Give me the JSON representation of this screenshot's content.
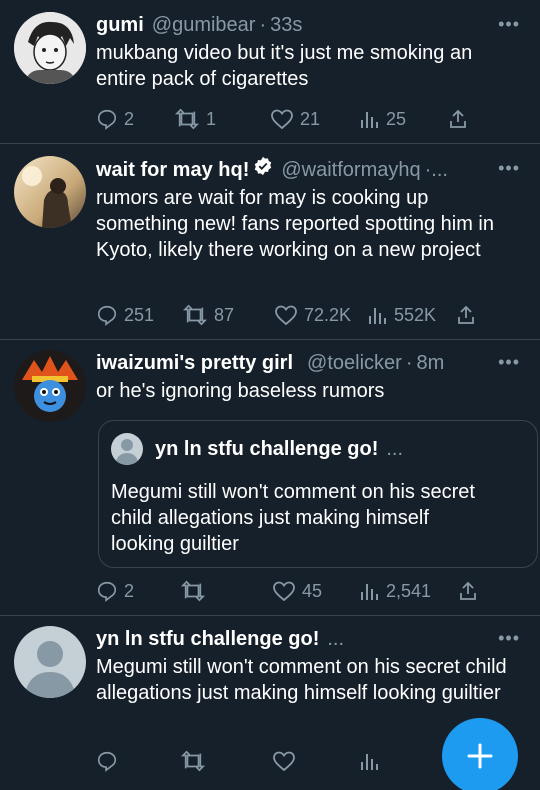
{
  "tweets": [
    {
      "name": "gumi",
      "handle": "@gumibear",
      "dot": "·",
      "time": "33s",
      "more": "•••",
      "text": "mukbang video but it's just me smoking an entire pack of cigarettes",
      "replies": "2",
      "retweets": "1",
      "likes": "21",
      "views": "25"
    },
    {
      "name": "wait for may hq!",
      "verified": true,
      "handle": "@waitformayhq",
      "dot": "·...",
      "more": "•••",
      "text": "rumors are wait for may is cooking up something new! fans reported spotting him in Kyoto, likely there working on a new project",
      "replies": "251",
      "retweets": "87",
      "likes": "72.2K",
      "views": "552K"
    },
    {
      "name": "iwaizumi's pretty girl",
      "handle": "@toelicker",
      "dot": "·",
      "time": "8m",
      "more": "•••",
      "text": "or he's ignoring baseless rumors",
      "quote": {
        "name": "yn ln stfu challenge go!",
        "ellipsis": "...",
        "text": "Megumi still won't comment on his secret child allegations just making himself looking guiltier"
      },
      "replies": "2",
      "retweets": "",
      "likes": "45",
      "views": "2,541"
    },
    {
      "name": "yn ln stfu challenge go!",
      "handle": "...",
      "more": "•••",
      "text": "Megumi still won't comment on his secret child allegations just making himself looking guiltier",
      "replies": "",
      "retweets": "",
      "likes": "",
      "views": ""
    }
  ],
  "compose_button": {
    "icon": "plus-icon"
  },
  "colors": {
    "background": "#15202b",
    "muted": "#8899a6",
    "divider": "#38444d",
    "accent": "#1d9bf0"
  }
}
